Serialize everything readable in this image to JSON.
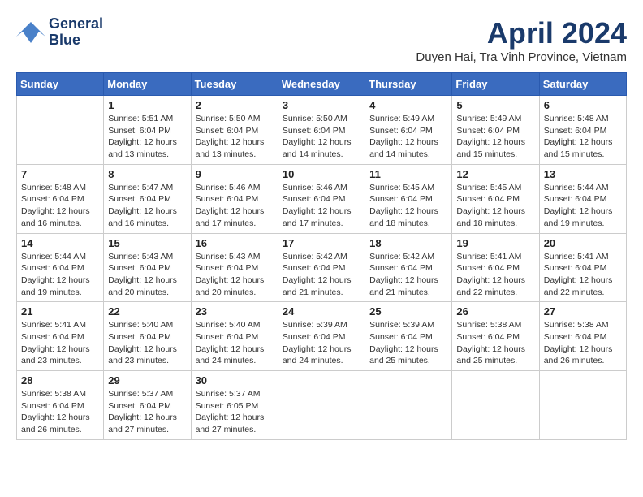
{
  "header": {
    "logo_line1": "General",
    "logo_line2": "Blue",
    "month_title": "April 2024",
    "location": "Duyen Hai, Tra Vinh Province, Vietnam"
  },
  "weekdays": [
    "Sunday",
    "Monday",
    "Tuesday",
    "Wednesday",
    "Thursday",
    "Friday",
    "Saturday"
  ],
  "weeks": [
    [
      {
        "day": "",
        "sunrise": "",
        "sunset": "",
        "daylight": ""
      },
      {
        "day": "1",
        "sunrise": "Sunrise: 5:51 AM",
        "sunset": "Sunset: 6:04 PM",
        "daylight": "Daylight: 12 hours and 13 minutes."
      },
      {
        "day": "2",
        "sunrise": "Sunrise: 5:50 AM",
        "sunset": "Sunset: 6:04 PM",
        "daylight": "Daylight: 12 hours and 13 minutes."
      },
      {
        "day": "3",
        "sunrise": "Sunrise: 5:50 AM",
        "sunset": "Sunset: 6:04 PM",
        "daylight": "Daylight: 12 hours and 14 minutes."
      },
      {
        "day": "4",
        "sunrise": "Sunrise: 5:49 AM",
        "sunset": "Sunset: 6:04 PM",
        "daylight": "Daylight: 12 hours and 14 minutes."
      },
      {
        "day": "5",
        "sunrise": "Sunrise: 5:49 AM",
        "sunset": "Sunset: 6:04 PM",
        "daylight": "Daylight: 12 hours and 15 minutes."
      },
      {
        "day": "6",
        "sunrise": "Sunrise: 5:48 AM",
        "sunset": "Sunset: 6:04 PM",
        "daylight": "Daylight: 12 hours and 15 minutes."
      }
    ],
    [
      {
        "day": "7",
        "sunrise": "Sunrise: 5:48 AM",
        "sunset": "Sunset: 6:04 PM",
        "daylight": "Daylight: 12 hours and 16 minutes."
      },
      {
        "day": "8",
        "sunrise": "Sunrise: 5:47 AM",
        "sunset": "Sunset: 6:04 PM",
        "daylight": "Daylight: 12 hours and 16 minutes."
      },
      {
        "day": "9",
        "sunrise": "Sunrise: 5:46 AM",
        "sunset": "Sunset: 6:04 PM",
        "daylight": "Daylight: 12 hours and 17 minutes."
      },
      {
        "day": "10",
        "sunrise": "Sunrise: 5:46 AM",
        "sunset": "Sunset: 6:04 PM",
        "daylight": "Daylight: 12 hours and 17 minutes."
      },
      {
        "day": "11",
        "sunrise": "Sunrise: 5:45 AM",
        "sunset": "Sunset: 6:04 PM",
        "daylight": "Daylight: 12 hours and 18 minutes."
      },
      {
        "day": "12",
        "sunrise": "Sunrise: 5:45 AM",
        "sunset": "Sunset: 6:04 PM",
        "daylight": "Daylight: 12 hours and 18 minutes."
      },
      {
        "day": "13",
        "sunrise": "Sunrise: 5:44 AM",
        "sunset": "Sunset: 6:04 PM",
        "daylight": "Daylight: 12 hours and 19 minutes."
      }
    ],
    [
      {
        "day": "14",
        "sunrise": "Sunrise: 5:44 AM",
        "sunset": "Sunset: 6:04 PM",
        "daylight": "Daylight: 12 hours and 19 minutes."
      },
      {
        "day": "15",
        "sunrise": "Sunrise: 5:43 AM",
        "sunset": "Sunset: 6:04 PM",
        "daylight": "Daylight: 12 hours and 20 minutes."
      },
      {
        "day": "16",
        "sunrise": "Sunrise: 5:43 AM",
        "sunset": "Sunset: 6:04 PM",
        "daylight": "Daylight: 12 hours and 20 minutes."
      },
      {
        "day": "17",
        "sunrise": "Sunrise: 5:42 AM",
        "sunset": "Sunset: 6:04 PM",
        "daylight": "Daylight: 12 hours and 21 minutes."
      },
      {
        "day": "18",
        "sunrise": "Sunrise: 5:42 AM",
        "sunset": "Sunset: 6:04 PM",
        "daylight": "Daylight: 12 hours and 21 minutes."
      },
      {
        "day": "19",
        "sunrise": "Sunrise: 5:41 AM",
        "sunset": "Sunset: 6:04 PM",
        "daylight": "Daylight: 12 hours and 22 minutes."
      },
      {
        "day": "20",
        "sunrise": "Sunrise: 5:41 AM",
        "sunset": "Sunset: 6:04 PM",
        "daylight": "Daylight: 12 hours and 22 minutes."
      }
    ],
    [
      {
        "day": "21",
        "sunrise": "Sunrise: 5:41 AM",
        "sunset": "Sunset: 6:04 PM",
        "daylight": "Daylight: 12 hours and 23 minutes."
      },
      {
        "day": "22",
        "sunrise": "Sunrise: 5:40 AM",
        "sunset": "Sunset: 6:04 PM",
        "daylight": "Daylight: 12 hours and 23 minutes."
      },
      {
        "day": "23",
        "sunrise": "Sunrise: 5:40 AM",
        "sunset": "Sunset: 6:04 PM",
        "daylight": "Daylight: 12 hours and 24 minutes."
      },
      {
        "day": "24",
        "sunrise": "Sunrise: 5:39 AM",
        "sunset": "Sunset: 6:04 PM",
        "daylight": "Daylight: 12 hours and 24 minutes."
      },
      {
        "day": "25",
        "sunrise": "Sunrise: 5:39 AM",
        "sunset": "Sunset: 6:04 PM",
        "daylight": "Daylight: 12 hours and 25 minutes."
      },
      {
        "day": "26",
        "sunrise": "Sunrise: 5:38 AM",
        "sunset": "Sunset: 6:04 PM",
        "daylight": "Daylight: 12 hours and 25 minutes."
      },
      {
        "day": "27",
        "sunrise": "Sunrise: 5:38 AM",
        "sunset": "Sunset: 6:04 PM",
        "daylight": "Daylight: 12 hours and 26 minutes."
      }
    ],
    [
      {
        "day": "28",
        "sunrise": "Sunrise: 5:38 AM",
        "sunset": "Sunset: 6:04 PM",
        "daylight": "Daylight: 12 hours and 26 minutes."
      },
      {
        "day": "29",
        "sunrise": "Sunrise: 5:37 AM",
        "sunset": "Sunset: 6:04 PM",
        "daylight": "Daylight: 12 hours and 27 minutes."
      },
      {
        "day": "30",
        "sunrise": "Sunrise: 5:37 AM",
        "sunset": "Sunset: 6:05 PM",
        "daylight": "Daylight: 12 hours and 27 minutes."
      },
      {
        "day": "",
        "sunrise": "",
        "sunset": "",
        "daylight": ""
      },
      {
        "day": "",
        "sunrise": "",
        "sunset": "",
        "daylight": ""
      },
      {
        "day": "",
        "sunrise": "",
        "sunset": "",
        "daylight": ""
      },
      {
        "day": "",
        "sunrise": "",
        "sunset": "",
        "daylight": ""
      }
    ]
  ]
}
